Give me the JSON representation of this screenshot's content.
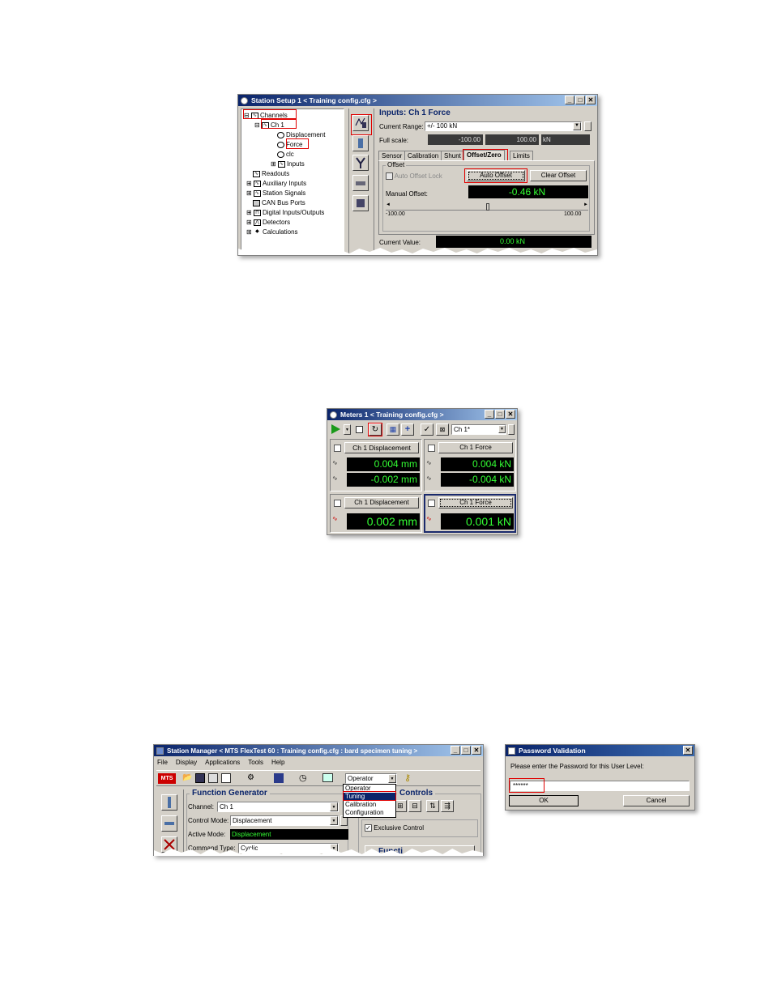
{
  "station_setup": {
    "title": "Station Setup 1 < Training config.cfg >",
    "tree": {
      "channels": "Channels",
      "ch1": "Ch 1",
      "displacement": "Displacement",
      "force": "Force",
      "clc": "clc",
      "inputs": "Inputs",
      "readouts": "Readouts",
      "auxiliary_inputs": "Auxiliary Inputs",
      "station_signals": "Station Signals",
      "can_bus_ports": "CAN Bus Ports",
      "digital_io": "Digital Inputs/Outputs",
      "detectors": "Detectors",
      "calculations": "Calculations"
    },
    "panel_title": "Inputs: Ch 1 Force",
    "current_range_label": "Current Range:",
    "current_range_value": "+/- 100 kN",
    "full_scale_label": "Full scale:",
    "full_scale_min": "-100.00",
    "full_scale_max": "100.00",
    "full_scale_unit": "kN",
    "tabs": [
      "Sensor",
      "Calibration",
      "Shunt",
      "Offset/Zero",
      "Limits"
    ],
    "offset_group": "Offset",
    "auto_offset_lock": "Auto Offset Lock",
    "auto_offset_button": "Auto Offset",
    "clear_offset_button": "Clear Offset",
    "manual_offset_label": "Manual Offset:",
    "manual_offset_value": "-0.46  kN",
    "slider_min": "-100.00",
    "slider_max": "100.00",
    "current_value_label": "Current Value:",
    "current_value": "0.00 kN"
  },
  "meters": {
    "title": "Meters 1 < Training config.cfg >",
    "channel_select": "Ch 1*",
    "cells": [
      {
        "label": "Ch 1 Displacement",
        "v1": "0.004 mm",
        "v2": "-0.002 mm"
      },
      {
        "label": "Ch 1 Force",
        "v1": "0.004 kN",
        "v2": "-0.004 kN"
      },
      {
        "label": "Ch 1 Displacement",
        "v1": "0.002 mm"
      },
      {
        "label": "Ch 1 Force",
        "v1": "0.001 kN"
      }
    ]
  },
  "station_manager": {
    "title": "Station Manager < MTS FlexTest 60 : Training config.cfg : bard specimen tuning >",
    "menu": [
      "File",
      "Display",
      "Applications",
      "Tools",
      "Help"
    ],
    "logo": "MTS",
    "user_level": "Operator",
    "user_levels": [
      "Operator",
      "Tuning",
      "Calibration",
      "Configuration"
    ],
    "fg_title": "Function Generator",
    "channel_label": "Channel:",
    "channel_value": "Ch 1",
    "control_mode_label": "Control Mode:",
    "control_mode_value": "Displacement",
    "active_mode_label": "Active Mode:",
    "active_mode_value": "Displacement",
    "command_type_label": "Command Type:",
    "command_type_value": "Cyclic",
    "controls_title": "Controls",
    "exclusive_control": "Exclusive Control",
    "function_button": "Functi"
  },
  "password": {
    "title": "Password Validation",
    "prompt": "Please enter the Password for this User Level:",
    "value": "******",
    "ok": "OK",
    "cancel": "Cancel"
  }
}
